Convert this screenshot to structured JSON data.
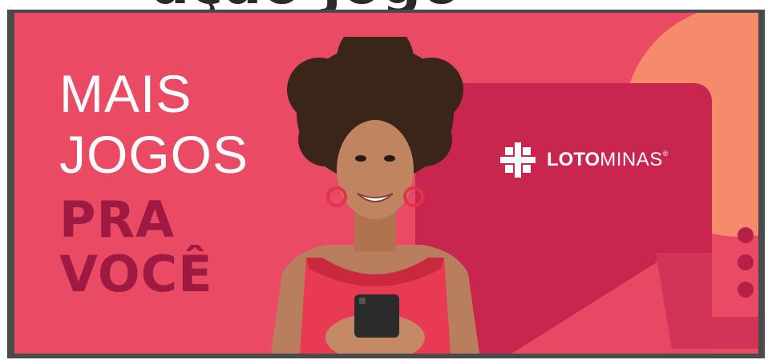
{
  "headline": {
    "line1": "MAIS",
    "line2": "JOGOS",
    "line3": "PRA",
    "line4": "VOCÊ"
  },
  "brand": {
    "name_bold": "LOTO",
    "name_light": "MINAS",
    "registered": "®"
  },
  "colors": {
    "background": "#ea4a64",
    "panel": "#c8264f",
    "peach": "#f68b6c",
    "headline_dark": "#9e1a43",
    "text_light": "#ffffff"
  }
}
